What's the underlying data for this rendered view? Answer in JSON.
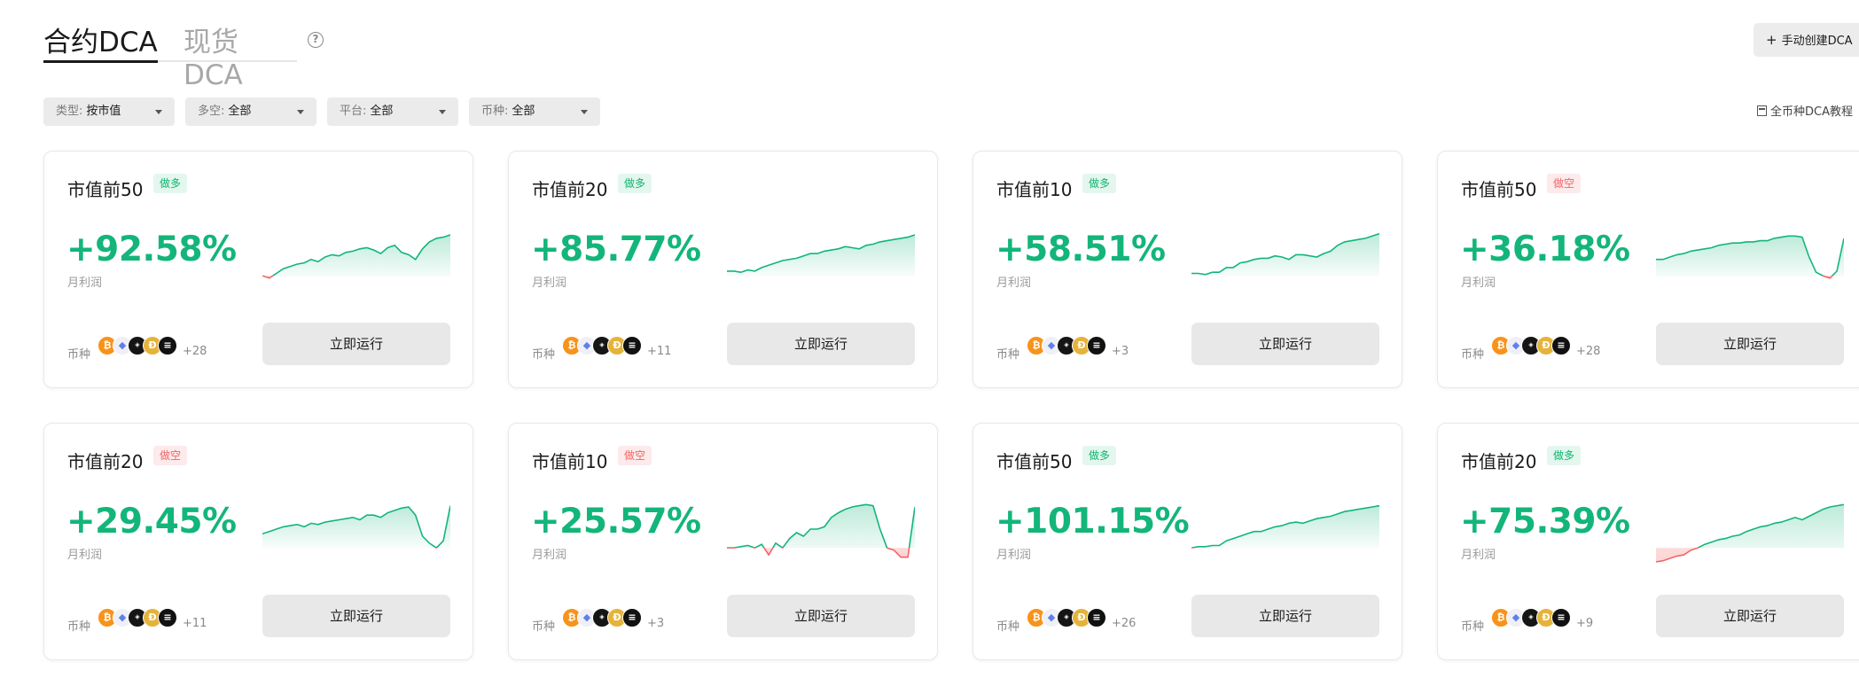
{
  "tabs": {
    "active": "合约DCA",
    "inactive": "现货DCA",
    "help_icon": "question-circle-icon"
  },
  "create_button": {
    "plus": "+",
    "label": "手动创建DCA"
  },
  "filters": [
    {
      "label": "类型:",
      "value": "按市值"
    },
    {
      "label": "多空:",
      "value": "全部"
    },
    {
      "label": "平台:",
      "value": "全部"
    },
    {
      "label": "币种:",
      "value": "全部"
    }
  ],
  "tutorial_link": "全币种DCA教程",
  "colors": {
    "profit_green": "#13b57a",
    "loss_red": "#f26565",
    "long_badge_bg": "#e3f7ee",
    "short_badge_bg": "#fdeaea"
  },
  "cards": [
    {
      "title": "市值前50",
      "badge": "做多",
      "direction": "long",
      "pct": "+92.58%",
      "pct_label": "月利润",
      "coins_label": "币种",
      "coin_more": "+28",
      "run_label": "立即运行",
      "spark": [
        38,
        40,
        36,
        32,
        30,
        28,
        27,
        24,
        26,
        22,
        20,
        21,
        18,
        17,
        15,
        14,
        16,
        19,
        14,
        12,
        18,
        20,
        24,
        15,
        9,
        6,
        5,
        3
      ]
    },
    {
      "title": "市值前20",
      "badge": "做多",
      "direction": "long",
      "pct": "+85.77%",
      "pct_label": "月利润",
      "coins_label": "币种",
      "coin_more": "+11",
      "run_label": "立即运行",
      "spark": [
        34,
        34,
        35,
        33,
        34,
        31,
        29,
        27,
        25,
        24,
        23,
        21,
        19,
        19,
        17,
        16,
        15,
        13,
        14,
        15,
        12,
        11,
        9,
        8,
        7,
        6,
        5,
        3
      ]
    },
    {
      "title": "市值前10",
      "badge": "做多",
      "direction": "long",
      "pct": "+58.51%",
      "pct_label": "月利润",
      "coins_label": "币种",
      "coin_more": "+3",
      "run_label": "立即运行",
      "spark": [
        36,
        36,
        37,
        35,
        35,
        31,
        31,
        27,
        26,
        24,
        23,
        23,
        21,
        22,
        24,
        20,
        20,
        21,
        22,
        19,
        17,
        12,
        9,
        8,
        7,
        6,
        4,
        2
      ]
    },
    {
      "title": "市值前50",
      "badge": "做空",
      "direction": "short",
      "pct": "+36.18%",
      "pct_label": "月利润",
      "coins_label": "币种",
      "coin_more": "+28",
      "run_label": "立即运行",
      "spark": [
        24,
        24,
        22,
        20,
        19,
        17,
        16,
        15,
        14,
        12,
        11,
        10,
        10,
        9,
        9,
        8,
        8,
        6,
        5,
        4,
        4,
        5,
        22,
        35,
        38,
        40,
        34,
        6
      ]
    },
    {
      "title": "市值前20",
      "badge": "做空",
      "direction": "short",
      "pct": "+29.45%",
      "pct_label": "月利润",
      "coins_label": "币种",
      "coin_more": "+11",
      "run_label": "立即运行",
      "spark": [
        26,
        24,
        22,
        20,
        19,
        18,
        20,
        17,
        18,
        16,
        15,
        14,
        13,
        12,
        14,
        10,
        10,
        12,
        8,
        6,
        4,
        3,
        10,
        28,
        34,
        38,
        32,
        2
      ]
    },
    {
      "title": "市值前10",
      "badge": "做空",
      "direction": "short",
      "pct": "+25.57%",
      "pct_label": "月利润",
      "coins_label": "币种",
      "coin_more": "+3",
      "run_label": "立即运行",
      "spark": [
        38,
        38,
        37,
        36,
        38,
        35,
        44,
        34,
        38,
        30,
        25,
        28,
        22,
        22,
        20,
        12,
        8,
        5,
        3,
        2,
        1,
        2,
        22,
        38,
        40,
        46,
        46,
        3
      ]
    },
    {
      "title": "市值前50",
      "badge": "做多",
      "direction": "long",
      "pct": "+101.15%",
      "pct_label": "月利润",
      "coins_label": "币种",
      "coin_more": "+26",
      "run_label": "立即运行",
      "spark": [
        38,
        37,
        37,
        36,
        36,
        32,
        30,
        28,
        26,
        24,
        24,
        22,
        20,
        19,
        17,
        16,
        17,
        15,
        13,
        12,
        11,
        9,
        7,
        6,
        5,
        4,
        3,
        2
      ]
    },
    {
      "title": "市值前20",
      "badge": "做多",
      "direction": "long",
      "pct": "+75.39%",
      "pct_label": "月利润",
      "coins_label": "币种",
      "coin_more": "+9",
      "run_label": "立即运行",
      "spark": [
        50,
        49,
        47,
        45,
        44,
        40,
        38,
        35,
        33,
        31,
        30,
        28,
        27,
        24,
        22,
        20,
        19,
        17,
        16,
        14,
        12,
        14,
        11,
        8,
        5,
        3,
        2,
        1
      ]
    }
  ]
}
